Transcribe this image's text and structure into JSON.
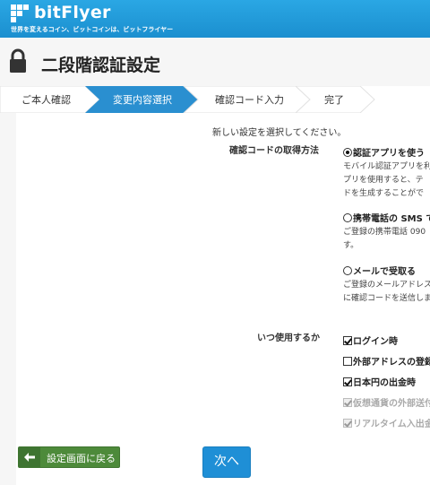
{
  "header": {
    "brand": "bitFlyer",
    "tagline": "世界を変えるコイン、ビットコインは、ビットフライヤー",
    "logo_icon": "bitflyer-logo-icon",
    "color": "#1b9ad8"
  },
  "page": {
    "title": "二段階認証設定",
    "icon": "lock-icon"
  },
  "steps": [
    {
      "label": "ご本人確認",
      "active": false
    },
    {
      "label": "変更内容選択",
      "active": true
    },
    {
      "label": "確認コード入力",
      "active": false
    },
    {
      "label": "完了",
      "active": false
    }
  ],
  "form": {
    "instruction": "新しい設定を選択してください。",
    "method": {
      "label": "確認コードの取得方法",
      "options": [
        {
          "label": "認証アプリを使う",
          "selected": true,
          "desc": [
            "モバイル認証アプリを利",
            "プリを使用すると、テ",
            "ドを生成することがで"
          ]
        },
        {
          "label": "携帯電話の SMS で",
          "selected": false,
          "desc": [
            "ご登録の携帯電話 090",
            "す。"
          ]
        },
        {
          "label": "メールで受取る",
          "selected": false,
          "desc": [
            "ご登録のメールアドレス",
            "に確認コードを送信しま"
          ]
        }
      ]
    },
    "when": {
      "label": "いつ使用するか",
      "options": [
        {
          "label": "ログイン時",
          "checked": true,
          "disabled": false
        },
        {
          "label": "外部アドレスの登録",
          "checked": false,
          "disabled": false
        },
        {
          "label": "日本円の出金時",
          "checked": true,
          "disabled": false
        },
        {
          "label": "仮想通貨の外部送付",
          "checked": true,
          "disabled": true
        },
        {
          "label": "リアルタイム入出金",
          "checked": true,
          "disabled": true
        }
      ]
    }
  },
  "buttons": {
    "back": "設定画面に戻る",
    "back_icon": "arrow-left-icon",
    "next": "次へ"
  },
  "colors": {
    "accent": "#1f8fd6",
    "back_button": "#4d8a3a",
    "active_step": "#2a8fd0"
  }
}
